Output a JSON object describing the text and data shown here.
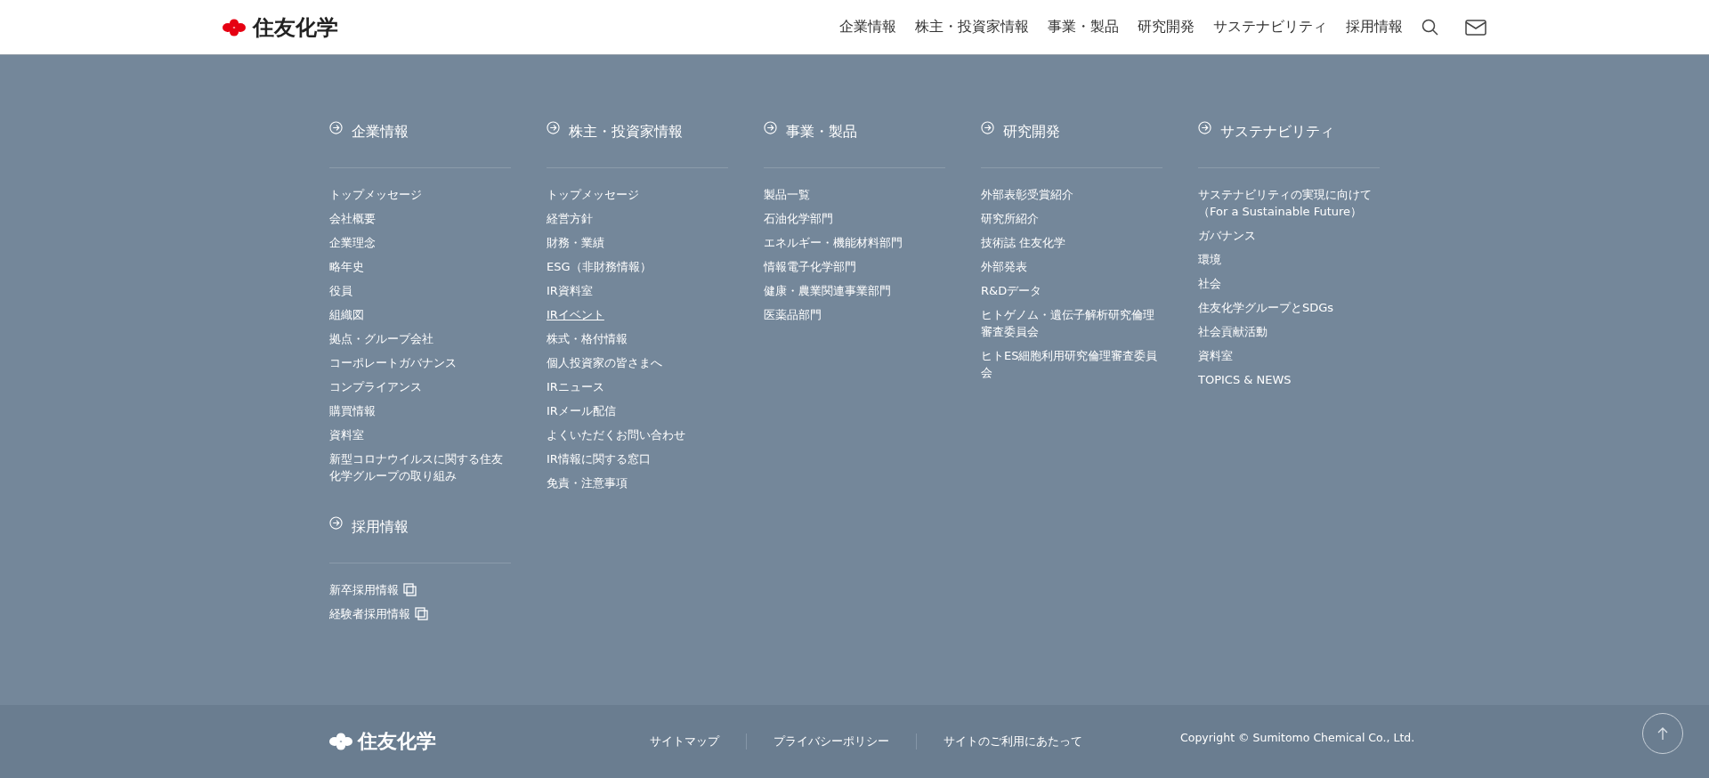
{
  "header": {
    "logo_text": "住友化学",
    "nav": [
      {
        "label": "企業情報"
      },
      {
        "label": "株主・投資家情報"
      },
      {
        "label": "事業・製品"
      },
      {
        "label": "研究開発"
      },
      {
        "label": "サステナビリティ"
      },
      {
        "label": "採用情報"
      }
    ]
  },
  "columns": [
    {
      "sections": [
        {
          "heading": "企業情報",
          "items": [
            {
              "label": "トップメッセージ",
              "underlined": false
            },
            {
              "label": "会社概要",
              "underlined": false
            },
            {
              "label": "企業理念",
              "underlined": false
            },
            {
              "label": "略年史",
              "underlined": false
            },
            {
              "label": "役員",
              "underlined": false
            },
            {
              "label": "組織図",
              "underlined": false
            },
            {
              "label": "拠点・グループ会社",
              "underlined": false
            },
            {
              "label": "コーポレートガバナンス",
              "underlined": false
            },
            {
              "label": "コンプライアンス",
              "underlined": false
            },
            {
              "label": "購買情報",
              "underlined": false
            },
            {
              "label": "資料室",
              "underlined": false
            },
            {
              "label": "新型コロナウイルスに関する住友化学グループの取り組み",
              "underlined": false
            }
          ]
        },
        {
          "heading": "採用情報",
          "items": [
            {
              "label": "新卒採用情報",
              "underlined": false,
              "external": true
            },
            {
              "label": "経験者採用情報",
              "underlined": false,
              "external": true
            }
          ]
        }
      ]
    },
    {
      "sections": [
        {
          "heading": "株主・投資家情報",
          "items": [
            {
              "label": "トップメッセージ",
              "underlined": false
            },
            {
              "label": "経営方針",
              "underlined": false
            },
            {
              "label": "財務・業績",
              "underlined": false
            },
            {
              "label": "ESG（非財務情報）",
              "underlined": false
            },
            {
              "label": "IR資料室",
              "underlined": false
            },
            {
              "label": "IRイベント",
              "underlined": true
            },
            {
              "label": "株式・格付情報",
              "underlined": false
            },
            {
              "label": "個人投資家の皆さまへ",
              "underlined": false
            },
            {
              "label": "IRニュース",
              "underlined": false
            },
            {
              "label": "IRメール配信",
              "underlined": false
            },
            {
              "label": "よくいただくお問い合わせ",
              "underlined": false
            },
            {
              "label": "IR情報に関する窓口",
              "underlined": false
            },
            {
              "label": "免責・注意事項",
              "underlined": false
            }
          ]
        }
      ]
    },
    {
      "sections": [
        {
          "heading": "事業・製品",
          "items": [
            {
              "label": "製品一覧",
              "underlined": false
            },
            {
              "label": "石油化学部門",
              "underlined": false
            },
            {
              "label": "エネルギー・機能材料部門",
              "underlined": false
            },
            {
              "label": "情報電子化学部門",
              "underlined": false
            },
            {
              "label": "健康・農業関連事業部門",
              "underlined": false
            },
            {
              "label": "医薬品部門",
              "underlined": false
            }
          ]
        }
      ]
    },
    {
      "sections": [
        {
          "heading": "研究開発",
          "items": [
            {
              "label": "外部表彰受賞紹介",
              "underlined": false
            },
            {
              "label": "研究所紹介",
              "underlined": false
            },
            {
              "label": "技術誌 住友化学",
              "underlined": false
            },
            {
              "label": "外部発表",
              "underlined": false
            },
            {
              "label": "R&Dデータ",
              "underlined": false
            },
            {
              "label": "ヒトゲノム・遺伝子解析研究倫理審査委員会",
              "underlined": false
            },
            {
              "label": "ヒトES細胞利用研究倫理審査委員会",
              "underlined": false
            }
          ]
        }
      ]
    },
    {
      "sections": [
        {
          "heading": "サステナビリティ",
          "items": [
            {
              "label": "サステナビリティの実現に向けて（For a Sustainable Future）",
              "underlined": false
            },
            {
              "label": "ガバナンス",
              "underlined": false
            },
            {
              "label": "環境",
              "underlined": false
            },
            {
              "label": "社会",
              "underlined": false
            },
            {
              "label": "住友化学グループとSDGs",
              "underlined": false
            },
            {
              "label": "社会貢献活動",
              "underlined": false
            },
            {
              "label": "資料室",
              "underlined": false
            },
            {
              "label": "TOPICS & NEWS",
              "underlined": false
            }
          ]
        }
      ]
    }
  ],
  "footer": {
    "logo_text": "住友化学",
    "links": [
      {
        "label": "サイトマップ"
      },
      {
        "label": "プライバシーポリシー"
      },
      {
        "label": "サイトのご利用にあたって"
      }
    ],
    "copyright": "Copyright © Sumitomo Chemical Co., Ltd."
  }
}
